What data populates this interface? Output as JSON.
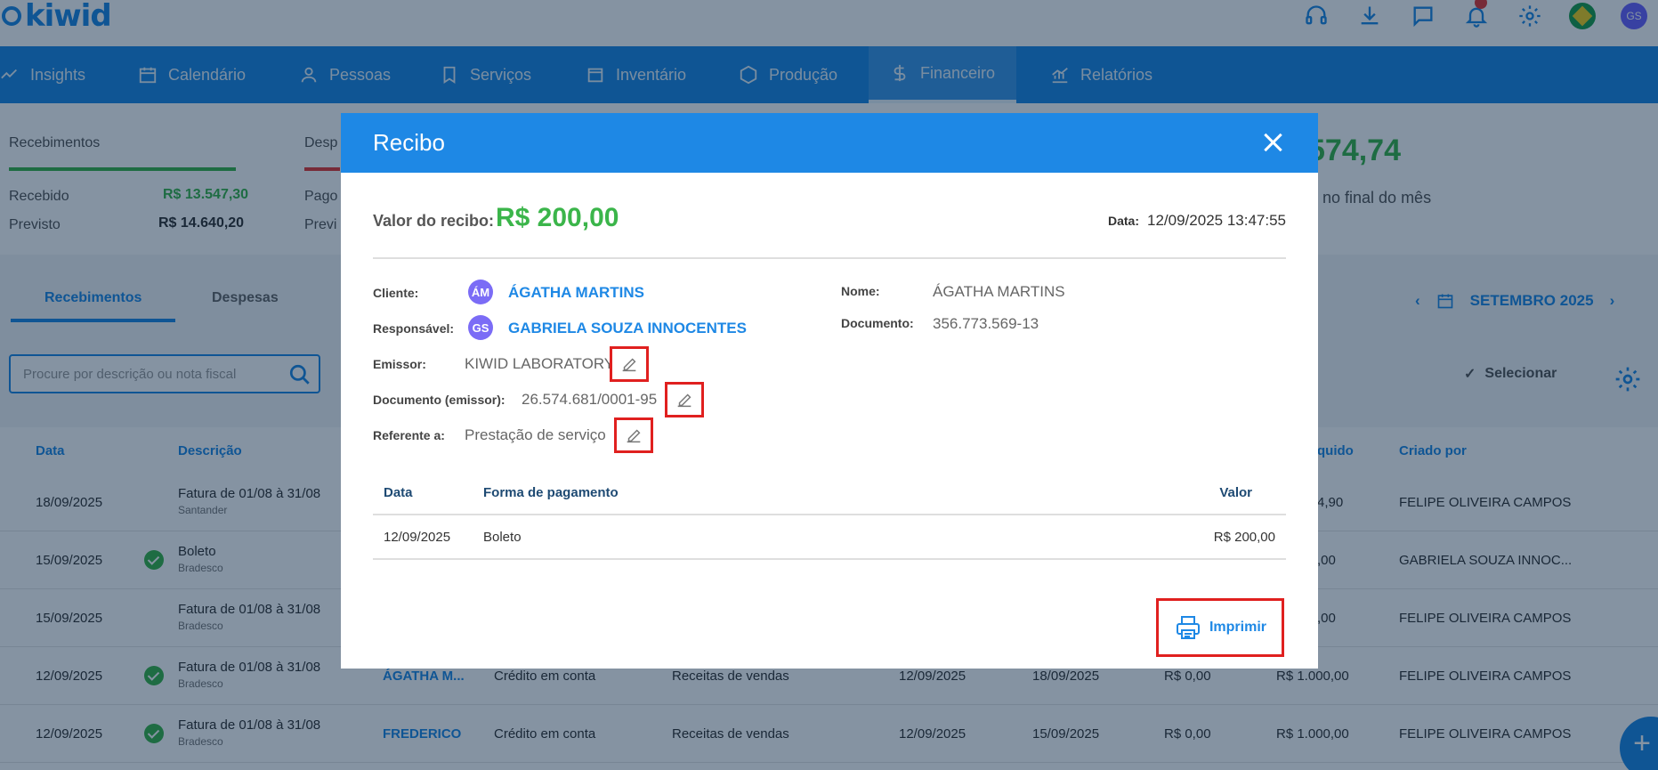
{
  "app": {
    "logo_text": "kiwid"
  },
  "nav": {
    "items": [
      {
        "label": "Insights",
        "icon": "trend-icon"
      },
      {
        "label": "Calendário",
        "icon": "calendar-icon"
      },
      {
        "label": "Pessoas",
        "icon": "person-icon"
      },
      {
        "label": "Serviços",
        "icon": "bookmark-icon"
      },
      {
        "label": "Inventário",
        "icon": "inventory-icon"
      },
      {
        "label": "Produção",
        "icon": "box-icon"
      },
      {
        "label": "Financeiro",
        "icon": "dollar-icon"
      },
      {
        "label": "Relatórios",
        "icon": "chart-icon"
      }
    ],
    "active": "Financeiro"
  },
  "summary": {
    "recebimentos_label": "Recebimentos",
    "despesas_label": "Desp",
    "recebido_label": "Recebido",
    "recebido_value": "R$ 13.547,30",
    "previsto_label": "Previsto",
    "previsto_value": "R$ 14.640,20",
    "pago_label": "Pago",
    "previ_label": "Previ",
    "balance_value": "574,74",
    "balance_caption": "no final do mês"
  },
  "tabs": {
    "recebimentos": "Recebimentos",
    "despesas": "Despesas"
  },
  "month": {
    "label": "SETEMBRO 2025"
  },
  "search": {
    "placeholder": "Procure por descrição ou nota fiscal"
  },
  "toolbar": {
    "select_label": "Selecionar"
  },
  "table": {
    "headers": {
      "data": "Data",
      "descricao": "Descrição",
      "liquido": "quido",
      "criado_por": "Criado por"
    },
    "rows": [
      {
        "date": "18/09/2025",
        "desc": "Fatura de 01/08 à 31/08",
        "bank": "Santander",
        "paid": false,
        "liquido": "4,90",
        "created_by": "FELIPE OLIVEIRA CAMPOS"
      },
      {
        "date": "15/09/2025",
        "desc": "Boleto",
        "bank": "Bradesco",
        "paid": true,
        "liquido": ",00",
        "created_by": "GABRIELA SOUZA INNOC..."
      },
      {
        "date": "15/09/2025",
        "desc": "Fatura de 01/08 à 31/08",
        "bank": "Bradesco",
        "paid": false,
        "liquido": ",00",
        "created_by": "FELIPE OLIVEIRA CAMPOS"
      },
      {
        "date": "12/09/2025",
        "desc": "Fatura de 01/08 à 31/08",
        "bank": "Bradesco",
        "paid": true,
        "client": "ÁGATHA M...",
        "method": "Crédito em conta",
        "category": "Receitas de vendas",
        "d1": "12/09/2025",
        "d2": "18/09/2025",
        "v1": "R$ 0,00",
        "liquido": "R$ 1.000,00",
        "created_by": "FELIPE OLIVEIRA CAMPOS"
      },
      {
        "date": "12/09/2025",
        "desc": "Fatura de 01/08 à 31/08",
        "bank": "Bradesco",
        "paid": true,
        "client": "FREDERICO",
        "method": "Crédito em conta",
        "category": "Receitas de vendas",
        "d1": "12/09/2025",
        "d2": "15/09/2025",
        "v1": "R$ 0,00",
        "liquido": "R$ 1.000,00",
        "created_by": "FELIPE OLIVEIRA CAMPOS"
      }
    ]
  },
  "user": {
    "initials": "GS"
  },
  "modal": {
    "title": "Recibo",
    "valor_label": "Valor do recibo:",
    "valor": "R$ 200,00",
    "data_label": "Data:",
    "data": "12/09/2025 13:47:55",
    "cliente_label": "Cliente:",
    "cliente_initials": "ÁM",
    "cliente": "ÁGATHA MARTINS",
    "responsavel_label": "Responsável:",
    "responsavel_initials": "GS",
    "responsavel": "GABRIELA SOUZA INNOCENTES",
    "emissor_label": "Emissor:",
    "emissor": "KIWID LABORATORY",
    "doc_emissor_label": "Documento (emissor):",
    "doc_emissor": "26.574.681/0001-95",
    "referente_label": "Referente a:",
    "referente": "Prestação de serviço",
    "nome_label": "Nome:",
    "nome": "ÁGATHA MARTINS",
    "documento_label": "Documento:",
    "documento": "356.773.569-13",
    "payments": {
      "headers": {
        "data": "Data",
        "forma": "Forma de pagamento",
        "valor": "Valor"
      },
      "rows": [
        {
          "data": "12/09/2025",
          "forma": "Boleto",
          "valor": "R$ 200,00"
        }
      ]
    },
    "print_label": "Imprimir"
  },
  "colors": {
    "primary": "#1e88e5",
    "success": "#3bb54a",
    "danger": "#e0201f"
  }
}
